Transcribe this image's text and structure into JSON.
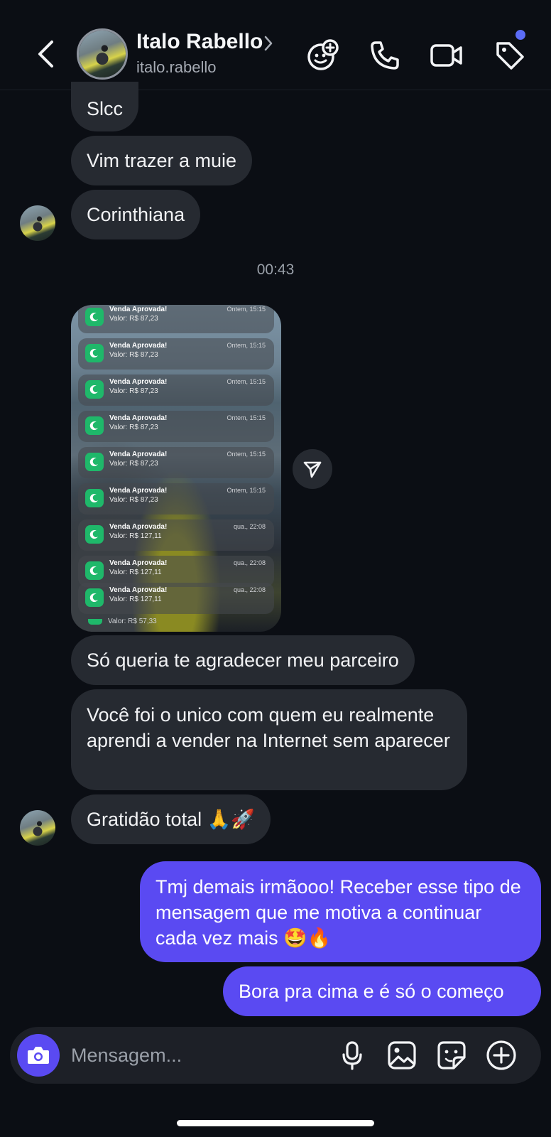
{
  "header": {
    "name": "Italo Rabello",
    "username": "italo.rabello"
  },
  "messages": {
    "m1": "Slcc",
    "m2": "Vim trazer a muie",
    "m3": "Corinthiana",
    "timestamp": "00:43",
    "m4": "Só queria te agradecer meu parceiro",
    "m5": "Você foi o unico com quem eu realmente aprendi a vender na Internet sem aparecer",
    "m6": "Gratidão total",
    "m6_emoji": "🙏🚀",
    "m7": "Tmj demais irmãooo! Receber esse tipo de mensagem que me motiva a continuar cada vez mais",
    "m7_emoji": "🤩🔥",
    "m8": "Bora pra cima e é só o começo"
  },
  "screenshot": {
    "notifications": [
      {
        "title": "Venda Aprovada!",
        "value": "Valor: R$ 87,23",
        "time": "Ontem, 15:15"
      },
      {
        "title": "Venda Aprovada!",
        "value": "Valor: R$ 87,23",
        "time": "Ontem, 15:15"
      },
      {
        "title": "Venda Aprovada!",
        "value": "Valor: R$ 87,23",
        "time": "Ontem, 15:15"
      },
      {
        "title": "Venda Aprovada!",
        "value": "Valor: R$ 87,23",
        "time": "Ontem, 15:15"
      },
      {
        "title": "Venda Aprovada!",
        "value": "Valor: R$ 87,23",
        "time": "Ontem, 15:15"
      },
      {
        "title": "Venda Aprovada!",
        "value": "Valor: R$ 87,23",
        "time": "Ontem, 15:15"
      },
      {
        "title": "Venda Aprovada!",
        "value": "Valor: R$ 127,11",
        "time": "qua., 22:08"
      },
      {
        "title": "Venda Aprovada!",
        "value": "Valor: R$ 127,11",
        "time": "qua., 22:08"
      },
      {
        "title": "Venda Aprovada!",
        "value": "Valor: R$ 127,11",
        "time": "qua., 22:08"
      }
    ],
    "partial_value": "Valor: R$ 57,33"
  },
  "composer": {
    "placeholder": "Mensagem..."
  },
  "colors": {
    "background": "#0b0e14",
    "incoming_bubble": "#262a31",
    "outgoing_bubble": "#5a4af2",
    "accent": "#5b6cf6",
    "notification_icon": "#1fb86a"
  },
  "icons": {
    "back": "chevron-left-icon",
    "effects": "face-plus-icon",
    "call": "phone-icon",
    "video": "video-camera-icon",
    "tag": "tag-icon",
    "share": "send-icon",
    "camera": "camera-icon",
    "mic": "microphone-icon",
    "gallery": "image-icon",
    "sticker": "sticker-icon",
    "add": "plus-circle-icon"
  }
}
